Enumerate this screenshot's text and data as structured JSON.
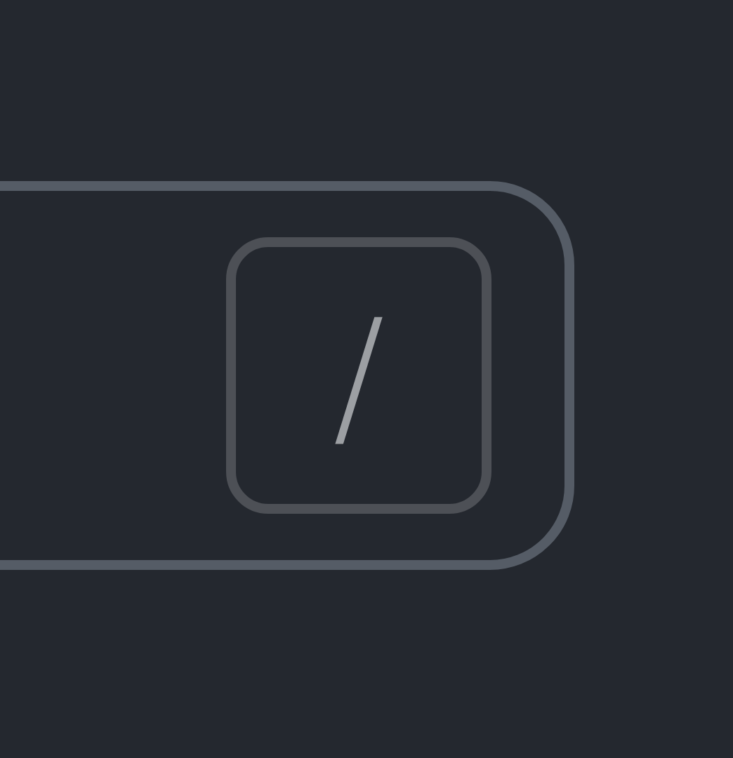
{
  "search": {
    "shortcut": "/"
  }
}
